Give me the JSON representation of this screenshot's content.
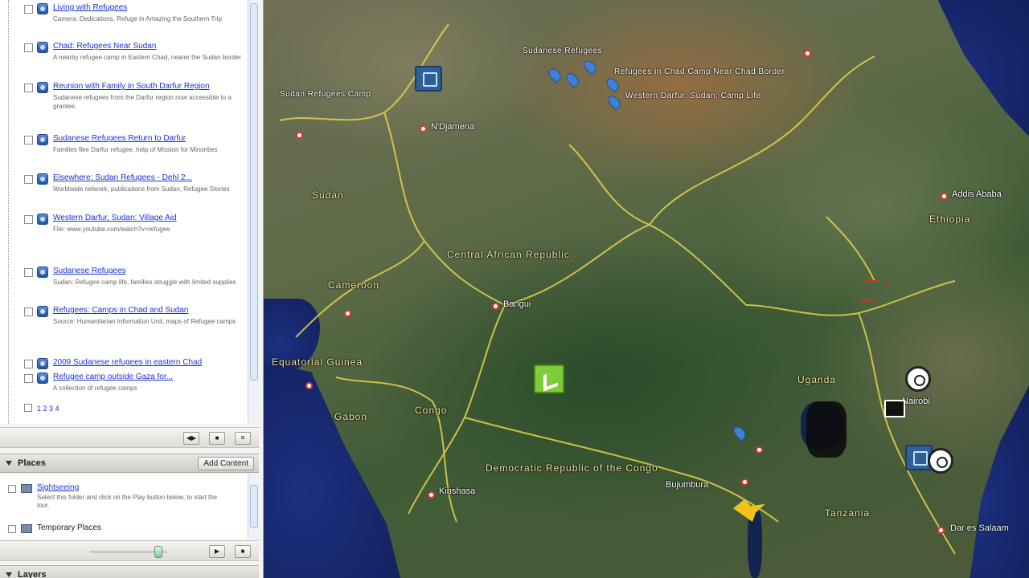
{
  "results": {
    "items": [
      {
        "title": "Living with Refugees",
        "snippet": "Camera: Dedications, Refuge in Amazing the Southern Trip"
      },
      {
        "title": "Chad: Refugees Near Sudan",
        "snippet": "A nearby refugee camp in Eastern Chad, nearer the Sudan border"
      },
      {
        "title": "Reunion with Family in South Darfur Region",
        "snippet": "Sudanese refugees from the Darfur region now accessible to a grantee."
      },
      {
        "title": "Sudanese Refugees Return to Darfur",
        "snippet": "Families flee Darfur refugee, help of Mission for Minorities"
      },
      {
        "title": "Elsewhere: Sudan Refugees - Dehl 2...",
        "snippet": "Worldwide network, publications from Sudan, Refugee Stories"
      },
      {
        "title": "Western Darfur, Sudan: Village Aid",
        "snippet": "File: www.youtube.com/watch?v=refugee"
      },
      {
        "title": "Sudanese Refugees",
        "snippet": "Sudan: Refugee camp life, families struggle with limited supplies"
      },
      {
        "title": "Refugees: Camps in Chad and Sudan",
        "snippet": "Source: Humanitarian Information Unit, maps of Refugee camps"
      },
      {
        "title": "2009 Sudanese refugees in eastern Chad",
        "snippet": ""
      },
      {
        "title": "Refugee camp outside Gaza for...",
        "snippet": "A collection of refugee camps"
      }
    ],
    "footer": "1 2 3 4"
  },
  "tour_buttons": [
    "◀▶",
    "■",
    "✕"
  ],
  "places": {
    "header": "Places",
    "add_button": "Add Content",
    "items": [
      {
        "label": "Sightseeing",
        "desc": "Select this folder and click on the Play button below, to start the tour."
      },
      {
        "label": "Temporary Places",
        "desc": ""
      }
    ]
  },
  "places_tour_buttons": [
    "▶",
    "■"
  ],
  "layers_header": "Layers",
  "map": {
    "countries": [
      {
        "name": "Central African Republic"
      },
      {
        "name": "Cameroon"
      },
      {
        "name": "Equatorial Guinea"
      },
      {
        "name": "Gabon"
      },
      {
        "name": "Congo"
      },
      {
        "name": "Democratic Republic of the Congo"
      },
      {
        "name": "Uganda"
      },
      {
        "name": "Tanzania"
      },
      {
        "name": "Ethiopia"
      },
      {
        "name": "Sudan"
      }
    ],
    "cities": [
      "Bangui",
      "Bujumbura",
      "Addis Ababa",
      "Nairobi",
      "Dar es Salaam",
      "N'Djamena",
      "Kinshasa"
    ],
    "markers": [
      "Sudanese Refugees",
      "Sudan Refugees Camp",
      "Refugees in Chad Camp Near Chad Border",
      "Western Darfur, Sudan: Camp Life"
    ]
  }
}
